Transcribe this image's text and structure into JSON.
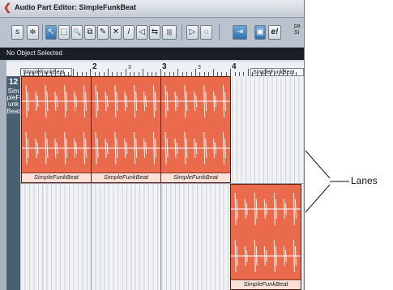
{
  "window": {
    "title": "Audio Part Editor: SimpleFunkBeat"
  },
  "toolbar": {
    "buttons": [
      {
        "icon": "s-badge-icon",
        "glyph": "s"
      },
      {
        "icon": "sliders-icon",
        "glyph": "≑"
      },
      {
        "icon": "arrow-select-icon",
        "glyph": "↖"
      },
      {
        "icon": "range-select-icon",
        "glyph": "⬚"
      },
      {
        "icon": "zoom-icon",
        "glyph": "🔍"
      },
      {
        "icon": "glue-icon",
        "glyph": "⧉"
      },
      {
        "icon": "draw-icon",
        "glyph": "✎"
      },
      {
        "icon": "erase-icon",
        "glyph": "✕"
      },
      {
        "icon": "pencil-icon",
        "glyph": "/"
      },
      {
        "icon": "speaker-icon",
        "glyph": "◁"
      },
      {
        "icon": "scrub-icon",
        "glyph": "⇆"
      },
      {
        "icon": "grid-icon",
        "glyph": "|||"
      },
      {
        "icon": "play-icon",
        "glyph": "▷"
      },
      {
        "icon": "loop-icon",
        "glyph": "◌"
      },
      {
        "icon": "snap-icon",
        "glyph": "⇥"
      },
      {
        "icon": "autoscroll-icon",
        "glyph": "▣"
      },
      {
        "icon": "edit-icon",
        "glyph": "e!"
      }
    ],
    "partial_label_1": "pa",
    "partial_label_2": "Si"
  },
  "info_line": {
    "text": "No Object Selected"
  },
  "ruler": {
    "bars": [
      "2",
      "3",
      "4"
    ],
    "beats": [
      "2",
      "3",
      "4"
    ],
    "clip_labels": [
      "SimpleFunkBeat",
      "SimpleFunkBeat"
    ]
  },
  "track": {
    "number": "12",
    "name": "SimpleFunkBeat"
  },
  "events": [
    {
      "name": "SimpleFunkBeat",
      "lane": 1
    },
    {
      "name": "SimpleFunkBeat",
      "lane": 1
    },
    {
      "name": "SimpleFunkBeat",
      "lane": 1
    },
    {
      "name": "SimpleFunkBeat",
      "lane": 2
    }
  ],
  "annotation": {
    "label": "Lanes"
  }
}
